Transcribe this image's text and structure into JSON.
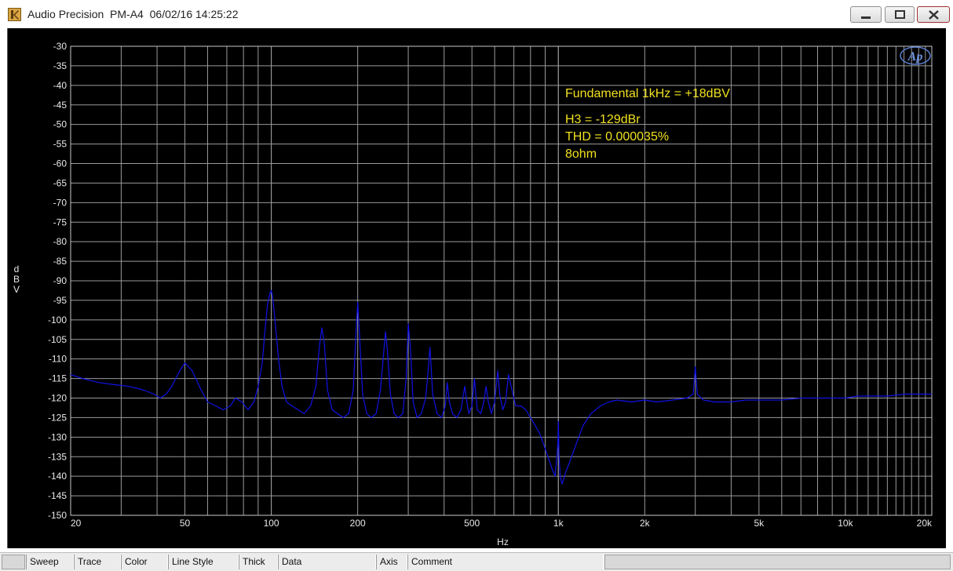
{
  "window": {
    "title": "Audio Precision  PM-A4  06/02/16 14:25:22",
    "minimize_icon": "minimize-icon",
    "maximize_icon": "maximize-icon",
    "close_icon": "close-icon"
  },
  "statusbar": {
    "items": [
      "Sweep",
      "Trace",
      "Color",
      "Line Style",
      "Thick",
      "Data",
      "Axis",
      "Comment"
    ]
  },
  "colors": {
    "plot_bg": "#000000",
    "grid": "#9a9a9a",
    "trace": "#1212e6",
    "annotation": "#f0e020",
    "axis_text": "#e8e8e8"
  },
  "chart_data": {
    "type": "line",
    "title": "",
    "xlabel": "Hz",
    "ylabel": "dBV",
    "x_scale": "log",
    "xlim": [
      20,
      20000
    ],
    "ylim": [
      -150,
      -30
    ],
    "grid": true,
    "x_tick_values": [
      20,
      50,
      100,
      200,
      500,
      1000,
      2000,
      5000,
      10000,
      20000
    ],
    "x_tick_labels": [
      "20",
      "50",
      "100",
      "200",
      "500",
      "1k",
      "2k",
      "5k",
      "10k",
      "20k"
    ],
    "y_tick_values": [
      -30,
      -35,
      -40,
      -45,
      -50,
      -55,
      -60,
      -65,
      -70,
      -75,
      -80,
      -85,
      -90,
      -95,
      -100,
      -105,
      -110,
      -115,
      -120,
      -125,
      -130,
      -135,
      -140,
      -145,
      -150
    ],
    "annotations": [
      "Fundamental 1kHz = +18dBV",
      "H3 = -129dBr",
      "THD = 0.000035%",
      "8ohm"
    ],
    "logo": "Ap",
    "series": [
      {
        "x": [
          20,
          22,
          25,
          28,
          32,
          36,
          39,
          41,
          43,
          45,
          48,
          50,
          53,
          57,
          60,
          64,
          68,
          72,
          75,
          79,
          83,
          87,
          90,
          93,
          95,
          97,
          99,
          100,
          101,
          103,
          106,
          109,
          113,
          118,
          124,
          130,
          137,
          143,
          147,
          150,
          153,
          157,
          163,
          170,
          178,
          186,
          193,
          197,
          200,
          203,
          208,
          215,
          223,
          232,
          240,
          246,
          250,
          254,
          260,
          268,
          277,
          287,
          295,
          300,
          305,
          312,
          322,
          333,
          345,
          352,
          357,
          365,
          378,
          392,
          404,
          410,
          417,
          428,
          443,
          458,
          472,
          480,
          488,
          500,
          510,
          522,
          537,
          550,
          560,
          570,
          585,
          600,
          615,
          625,
          640,
          655,
          670,
          690,
          710,
          740,
          770,
          800,
          830,
          860,
          890,
          920,
          950,
          975,
          985,
          995,
          1000,
          1005,
          1015,
          1030,
          1060,
          1100,
          1150,
          1220,
          1300,
          1400,
          1500,
          1600,
          1800,
          2000,
          2200,
          2500,
          2800,
          2950,
          3000,
          3050,
          3200,
          3500,
          4000,
          4500,
          5000,
          6000,
          7000,
          8000,
          9000,
          10000,
          11000,
          12000,
          14000,
          16000,
          18000,
          20000
        ],
        "y": [
          -114,
          -115,
          -116,
          -116.5,
          -117,
          -118,
          -119,
          -120,
          -119,
          -117,
          -113,
          -111,
          -113,
          -118,
          -121,
          -122,
          -123,
          -122,
          -120,
          -121,
          -123,
          -121,
          -117,
          -111,
          -103,
          -96,
          -93,
          -92.5,
          -94,
          -100,
          -110,
          -117,
          -121,
          -122,
          -123,
          -124,
          -122,
          -117,
          -107,
          -102,
          -106,
          -118,
          -123,
          -124,
          -125,
          -124,
          -118,
          -104,
          -95.5,
          -104,
          -119,
          -124,
          -125,
          -124,
          -118,
          -109,
          -103,
          -108,
          -119,
          -124,
          -125,
          -124,
          -115,
          -101,
          -107,
          -121,
          -125,
          -124,
          -120,
          -113,
          -107,
          -119,
          -124,
          -125,
          -122,
          -116,
          -121,
          -124,
          -125,
          -123,
          -117,
          -121,
          -124,
          -122,
          -115,
          -123,
          -124,
          -121,
          -117,
          -121,
          -124,
          -121,
          -113,
          -119,
          -123,
          -121,
          -114,
          -118,
          -122,
          -122,
          -123,
          -125,
          -127,
          -129,
          -132,
          -135,
          -138,
          -140,
          -136,
          -132,
          -126,
          -134,
          -140,
          -142,
          -139,
          -136,
          -132,
          -127,
          -124,
          -122,
          -121,
          -120.5,
          -121,
          -120.5,
          -121,
          -120.5,
          -120,
          -119,
          -112,
          -119,
          -120.5,
          -121,
          -121,
          -120.5,
          -120.5,
          -120.5,
          -120,
          -120,
          -120,
          -120,
          -119.5,
          -119.5,
          -119.5,
          -119,
          -119,
          -119
        ]
      }
    ]
  }
}
